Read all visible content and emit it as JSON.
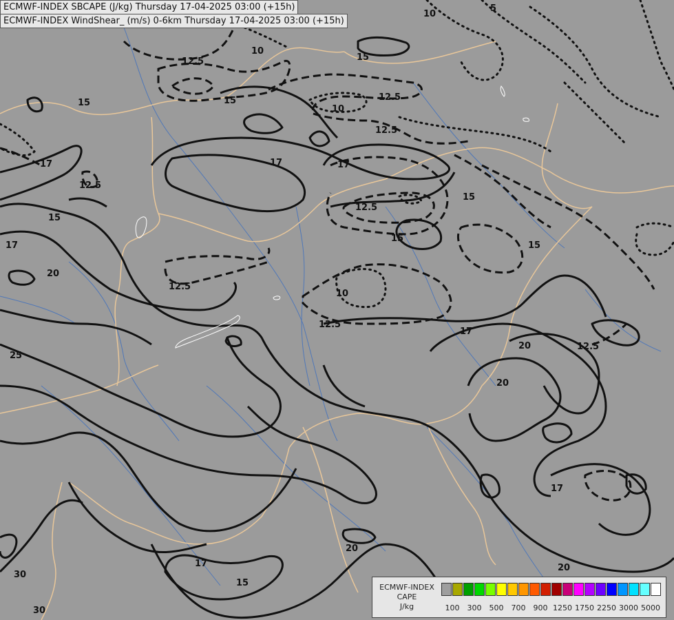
{
  "titles": {
    "line1": "ECMWF-INDEX SBCAPE (J/kg) Thursday 17-04-2025 03:00 (+15h)",
    "line2": "ECMWF-INDEX WindShear_ (m/s) 0-6km Thursday 17-04-2025 03:00 (+15h)"
  },
  "contour_labels": [
    "5",
    "10",
    "10",
    "10",
    "10",
    "12.5",
    "12.5",
    "12.5",
    "12.5",
    "12.5",
    "12.5",
    "12.5",
    "12.5",
    "15",
    "15",
    "15",
    "15",
    "15",
    "15",
    "15",
    "15",
    "17",
    "17",
    "17",
    "17",
    "17",
    "17",
    "17",
    "20",
    "20",
    "20",
    "20",
    "20",
    "25",
    "30",
    "30"
  ],
  "legend": {
    "title": "ECMWF-INDEX",
    "subtitle": "CAPE",
    "unit": "J/kg",
    "colors": [
      "#9e9e9e",
      "#a8a800",
      "#00a000",
      "#00d800",
      "#78ff00",
      "#ffff00",
      "#ffc800",
      "#ff9600",
      "#ff5a00",
      "#d21e00",
      "#a00000",
      "#c80078",
      "#ff00ff",
      "#b400ff",
      "#6e00ff",
      "#0000ff",
      "#0096ff",
      "#00e1ff",
      "#64ffff",
      "#ffffff"
    ],
    "ticks": [
      "100",
      "300",
      "500",
      "700",
      "900",
      "1250",
      "1750",
      "2250",
      "3000",
      "5000"
    ]
  }
}
